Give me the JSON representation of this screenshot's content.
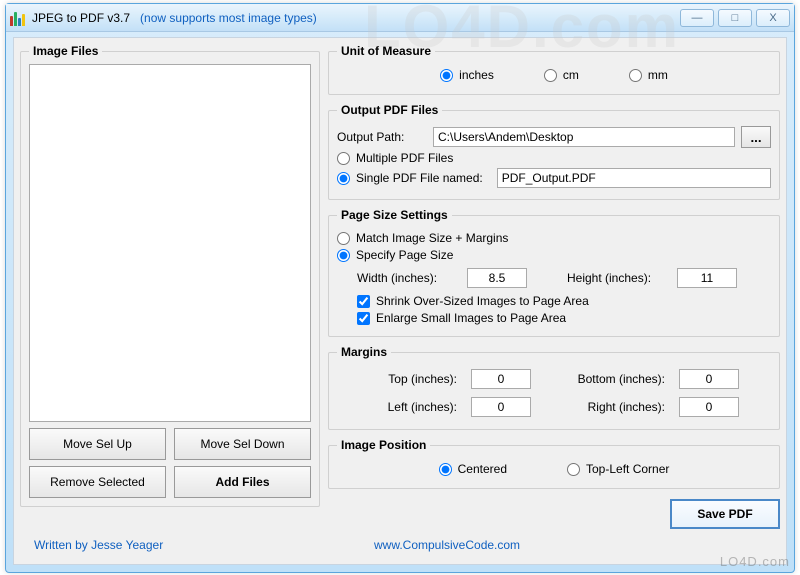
{
  "window": {
    "title": "JPEG to PDF  v3.7",
    "subtitle": "(now supports most image types)",
    "minimize": "—",
    "maximize": "□",
    "close": "X"
  },
  "left": {
    "group_label": "Image Files",
    "move_up": "Move Sel Up",
    "move_down": "Move Sel Down",
    "remove": "Remove Selected",
    "add": "Add Files"
  },
  "unit": {
    "group_label": "Unit of Measure",
    "inches": "inches",
    "cm": "cm",
    "mm": "mm"
  },
  "output": {
    "group_label": "Output PDF Files",
    "path_label": "Output Path:",
    "path_value": "C:\\Users\\Andem\\Desktop",
    "browse": "...",
    "multiple": "Multiple PDF Files",
    "single": "Single PDF File named:",
    "single_value": "PDF_Output.PDF"
  },
  "page": {
    "group_label": "Page Size Settings",
    "match": "Match Image Size + Margins",
    "specify": "Specify Page Size",
    "width_label": "Width (inches):",
    "width_value": "8.5",
    "height_label": "Height (inches):",
    "height_value": "11",
    "shrink": "Shrink Over-Sized Images to Page Area",
    "enlarge": "Enlarge Small Images to Page Area"
  },
  "margins": {
    "group_label": "Margins",
    "top_label": "Top (inches):",
    "top_value": "0",
    "bottom_label": "Bottom (inches):",
    "bottom_value": "0",
    "left_label": "Left (inches):",
    "left_value": "0",
    "right_label": "Right (inches):",
    "right_value": "0"
  },
  "position": {
    "group_label": "Image Position",
    "centered": "Centered",
    "topleft": "Top-Left Corner"
  },
  "save": "Save PDF",
  "footer": {
    "author": "Written by Jesse Yeager",
    "link": "www.CompulsiveCode.com"
  },
  "watermark": {
    "main": "LO4D.com",
    "small": "LO4D.com"
  }
}
